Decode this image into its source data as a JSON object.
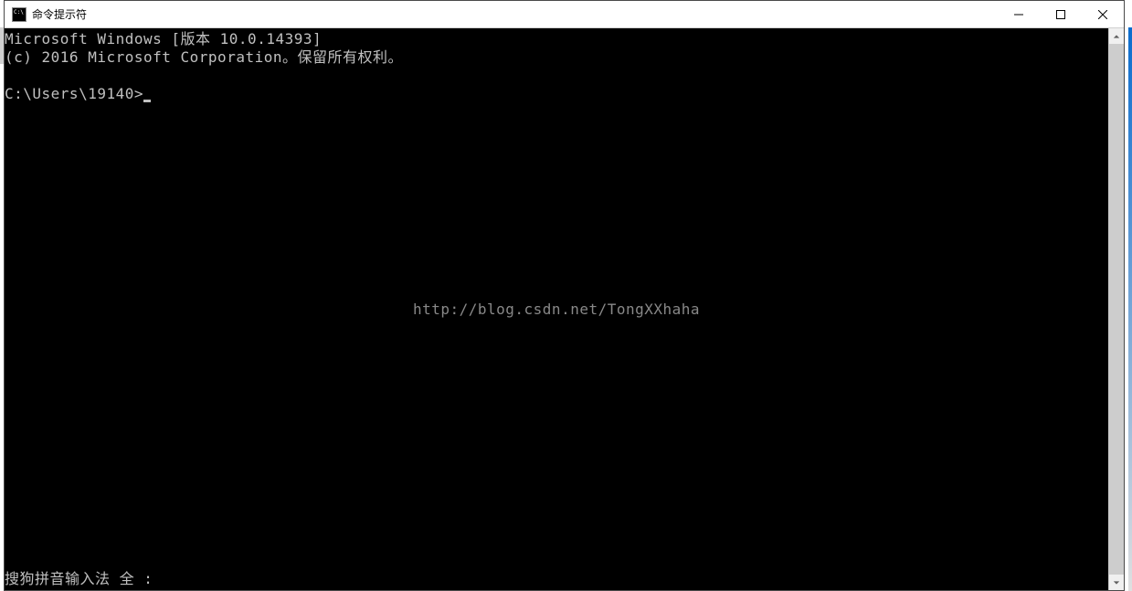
{
  "window": {
    "title": "命令提示符"
  },
  "terminal": {
    "line1": "Microsoft Windows [版本 10.0.14393]",
    "line2": "(c) 2016 Microsoft Corporation。保留所有权利。",
    "prompt": "C:\\Users\\19140>",
    "ime_status": "搜狗拼音输入法 全 :"
  },
  "watermark": "http://blog.csdn.net/TongXXhaha"
}
